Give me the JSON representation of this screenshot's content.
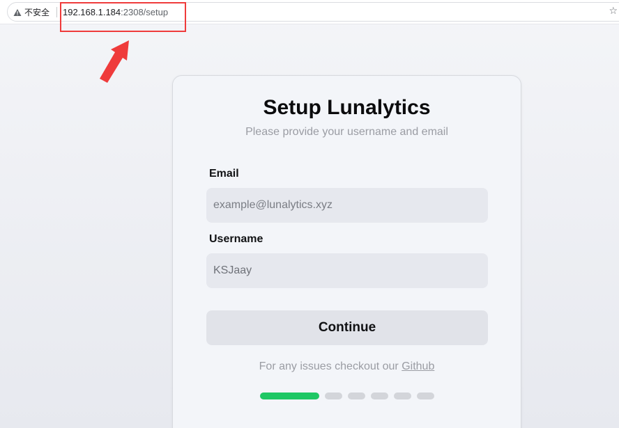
{
  "browser": {
    "security_label": "不安全",
    "url_host": "192.168.1.184",
    "url_path": ":2308/setup",
    "warning_icon": "warning-triangle-icon",
    "star_icon": "star-outline-icon"
  },
  "setup": {
    "title": "Setup Lunalytics",
    "subtitle": "Please provide your username and email",
    "email_label": "Email",
    "email_placeholder": "example@lunalytics.xyz",
    "email_value": "",
    "username_label": "Username",
    "username_placeholder": "",
    "username_value": "KSJaay",
    "continue_label": "Continue",
    "help_prefix": "For any issues checkout our ",
    "help_link": "Github"
  },
  "progress": {
    "current_step": 1,
    "total_steps": 6
  },
  "colors": {
    "annotation": "#ef3b3b",
    "progress_active": "#1ec764",
    "progress_inactive": "#d3d5da"
  }
}
